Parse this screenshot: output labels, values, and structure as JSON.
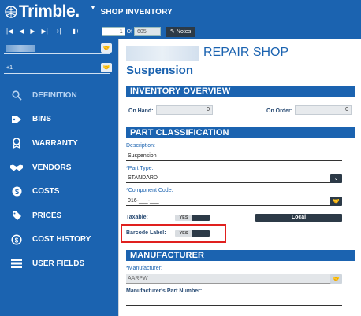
{
  "header": {
    "brand": "Trimble.",
    "title": "SHOP INVENTORY"
  },
  "toolbar": {
    "first": "|◀",
    "prev": "◀",
    "next": "▶",
    "last": "▶|",
    "jump": "➔|",
    "new": "▮+",
    "record_current": "1",
    "record_of": "Of",
    "record_total": "605",
    "notes_label": "Notes"
  },
  "sidebar": {
    "field2_value": "+1",
    "items": [
      {
        "label": "DEFINITION",
        "icon": "search-icon"
      },
      {
        "label": "BINS",
        "icon": "tag-icon"
      },
      {
        "label": "WARRANTY",
        "icon": "ribbon-icon"
      },
      {
        "label": "VENDORS",
        "icon": "handshake-icon"
      },
      {
        "label": "COSTS",
        "icon": "dollar-coin-icon"
      },
      {
        "label": "PRICES",
        "icon": "price-tag-icon"
      },
      {
        "label": "COST HISTORY",
        "icon": "dollar-history-icon"
      },
      {
        "label": "USER FIELDS",
        "icon": "list-icon"
      }
    ]
  },
  "main": {
    "shop_name": "REPAIR SHOP",
    "subtitle": "Suspension",
    "inventory_overview": {
      "header": "INVENTORY OVERVIEW",
      "on_hand_label": "On Hand:",
      "on_hand_value": "0",
      "on_order_label": "On Order:",
      "on_order_value": "0"
    },
    "part_classification": {
      "header": "PART CLASSIFICATION",
      "description_label": "Description:",
      "description_value": "Suspension",
      "part_type_label": "*Part Type:",
      "part_type_value": "STANDARD",
      "component_code_label": "*Component Code:",
      "component_code_value": "016-___-___",
      "taxable_label": "Taxable:",
      "taxable_toggle": "YES",
      "local_button": "Local",
      "barcode_label": "Barcode Label:",
      "barcode_toggle": "YES"
    },
    "manufacturer": {
      "header": "MANUFACTURER",
      "manufacturer_label": "*Manufacturer:",
      "manufacturer_value": "AARPW",
      "part_number_label": "Manufacturer's Part Number:"
    }
  }
}
